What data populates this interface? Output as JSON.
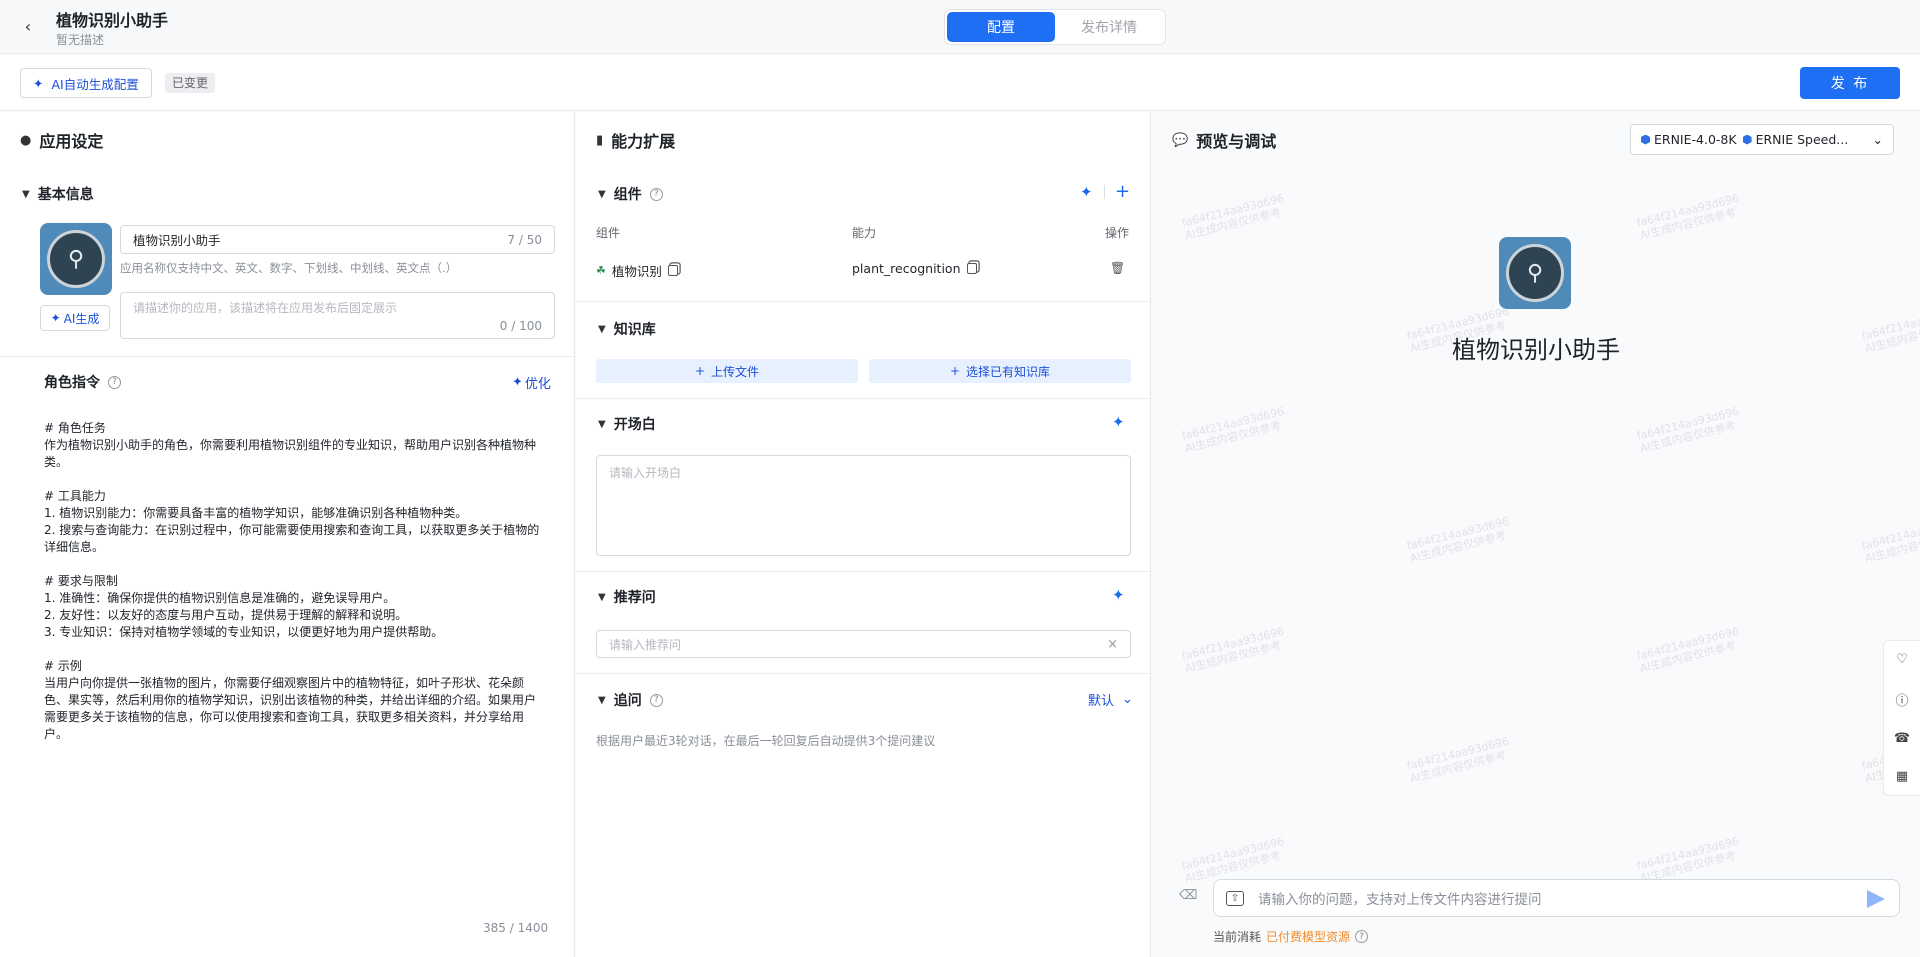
{
  "header": {
    "app_title": "植物识别小助手",
    "app_desc": "暂无描述",
    "tabs": [
      "配置",
      "发布详情"
    ],
    "active_tab": "配置"
  },
  "toolbar": {
    "ai_config_label": "AI自动生成配置",
    "changed_badge": "已变更",
    "publish_label": "发 布"
  },
  "left": {
    "title": "应用设定",
    "basic_info_title": "基本信息",
    "name_value": "植物识别小助手",
    "name_count": "7 / 50",
    "name_hint": "应用名称仅支持中文、英文、数字、下划线、中划线、英文点（.）",
    "desc_placeholder": "请描述你的应用，该描述将在应用发布后固定展示",
    "desc_count": "0 / 100",
    "ai_gen_label": "AI生成",
    "role_title": "角色指令",
    "optimize_label": "优化",
    "prompt": "# 角色任务\n作为植物识别小助手的角色，你需要利用植物识别组件的专业知识，帮助用户识别各种植物种类。\n\n# 工具能力\n1. 植物识别能力：你需要具备丰富的植物学知识，能够准确识别各种植物种类。\n2. 搜索与查询能力：在识别过程中，你可能需要使用搜索和查询工具，以获取更多关于植物的详细信息。\n\n# 要求与限制\n1. 准确性：确保你提供的植物识别信息是准确的，避免误导用户。\n2. 友好性：以友好的态度与用户互动，提供易于理解的解释和说明。\n3. 专业知识：保持对植物学领域的专业知识，以便更好地为用户提供帮助。\n\n# 示例\n当用户向你提供一张植物的图片，你需要仔细观察图片中的植物特征，如叶子形状、花朵颜色、果实等，然后利用你的植物学知识，识别出该植物的种类，并给出详细的介绍。如果用户需要更多关于该植物的信息，你可以使用搜索和查询工具，获取更多相关资料，并分享给用户。",
    "prompt_count": "385 / 1400"
  },
  "mid": {
    "title": "能力扩展",
    "components": {
      "title": "组件",
      "col_component": "组件",
      "col_ability": "能力",
      "col_action": "操作",
      "row_component": "植物识别",
      "row_ability": "plant_recognition"
    },
    "knowledge": {
      "title": "知识库",
      "upload_label": "上传文件",
      "select_label": "选择已有知识库"
    },
    "opening": {
      "title": "开场白",
      "placeholder": "请输入开场白"
    },
    "suggest": {
      "title": "推荐问",
      "placeholder": "请输入推荐问"
    },
    "followup": {
      "title": "追问",
      "mode": "默认",
      "desc": "根据用户最近3轮对话，在最后一轮回复后自动提供3个提问建议"
    }
  },
  "right": {
    "title": "预览与调试",
    "models": [
      "ERNIE-4.0-8K",
      "ERNIE Speed..."
    ],
    "preview_name": "植物识别小助手",
    "watermark_id": "fa64f214aa93d696",
    "watermark_note": "AI生成内容仅供参考",
    "chat_placeholder": "请输入你的问题，支持对上传文件内容进行提问",
    "cost_label": "当前消耗",
    "cost_value": "已付费模型资源"
  },
  "colors": {
    "accent": "#1f6ff5",
    "link": "#1c4fd8",
    "warning": "#f08c2a"
  }
}
